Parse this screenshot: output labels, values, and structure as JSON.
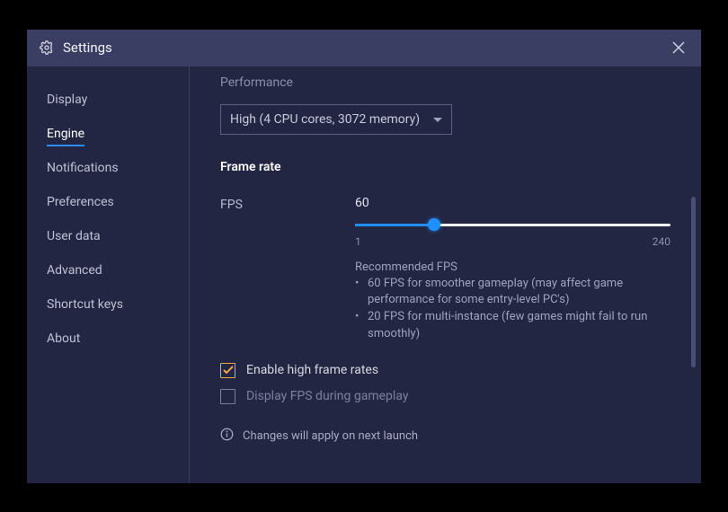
{
  "title": "Settings",
  "sidebar": {
    "items": [
      {
        "label": "Display"
      },
      {
        "label": "Engine"
      },
      {
        "label": "Notifications"
      },
      {
        "label": "Preferences"
      },
      {
        "label": "User data"
      },
      {
        "label": "Advanced"
      },
      {
        "label": "Shortcut keys"
      },
      {
        "label": "About"
      }
    ],
    "activeIndex": 1
  },
  "content": {
    "performance": {
      "label": "Performance",
      "selected": "High (4 CPU cores, 3072 memory)"
    },
    "framerate": {
      "heading": "Frame rate",
      "fpsLabel": "FPS",
      "fpsValue": "60",
      "min": "1",
      "max": "240",
      "recTitle": "Recommended FPS",
      "recItems": [
        "60 FPS for smoother gameplay (may affect game performance for some entry-level PC's)",
        "20 FPS for multi-instance (few games might fail to run smoothly)"
      ]
    },
    "checkboxes": {
      "highFrameRates": {
        "label": "Enable high frame rates",
        "checked": true
      },
      "displayFps": {
        "label": "Display FPS during gameplay",
        "checked": false
      }
    },
    "notice": "Changes will apply on next launch"
  }
}
